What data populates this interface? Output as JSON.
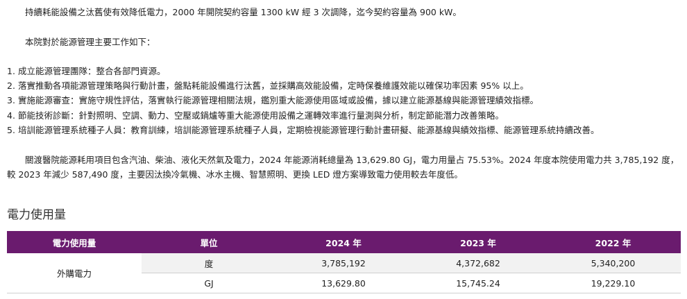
{
  "intro": "持續耗能設備之汰舊使有效降低電力，2000 年開院契約容量 1300 kW 經 3 次調降，迄今契約容量為 900 kW。",
  "work_intro": "本院對於能源管理主要工作如下：",
  "work_items": [
    {
      "num": "1.",
      "text": "成立能源管理團隊：整合各部門資源。"
    },
    {
      "num": "2.",
      "text": "落實推動各項能源管理策略與行動計畫，盤點耗能設備進行汰舊，並採購高效能設備，定時保養維護效能以確保功率因素 95% 以上。"
    },
    {
      "num": "3.",
      "text": "實施能源審查：實施守規性評估，落實執行能源管理相關法規，鑑別重大能源使用區域或設備，據以建立能源基線與能源管理績效指標。"
    },
    {
      "num": "4.",
      "text": "節能技術診斷：針對照明、空調、動力、空壓或鍋爐等重大能源使用設備之運轉效率進行量測與分析，制定節能潛力改善策略。"
    },
    {
      "num": "5.",
      "text": "培訓能源管理系統種子人員：教育訓練，培訓能源管理系統種子人員，定期檢視能源管理行動計畫研擬、能源基線與績效指標、能源管理系統持續改善。"
    }
  ],
  "consumption_para": [
    "關渡醫院能源耗用項目包含汽油、柴油、液化天然氣及電力，2024 年能源消耗總量為 13,629.80 GJ，電力用量占 75.53%。2024 年度本院使用電力共 3,785,192 度，",
    "較 2023 年減少 587,490 度，主要因汰換冷氣機、冰水主機、智慧照明、更換 LED 燈方案導致電力使用較去年度低。"
  ],
  "section_title": "電力使用量",
  "table": {
    "headers": [
      "電力使用量",
      "單位",
      "2024 年",
      "2023 年",
      "2022 年"
    ],
    "row_label": "外購電力",
    "rows": [
      {
        "unit": "度",
        "v2024": "3,785,192",
        "v2023": "4,372,682",
        "v2022": "5,340,200"
      },
      {
        "unit": "GJ",
        "v2024": "13,629.80",
        "v2023": "15,745.24",
        "v2022": "19,229.10"
      }
    ]
  },
  "colors": {
    "header_bg": "#6a1b6e",
    "row_alt_bg": "#f2f2f2"
  }
}
